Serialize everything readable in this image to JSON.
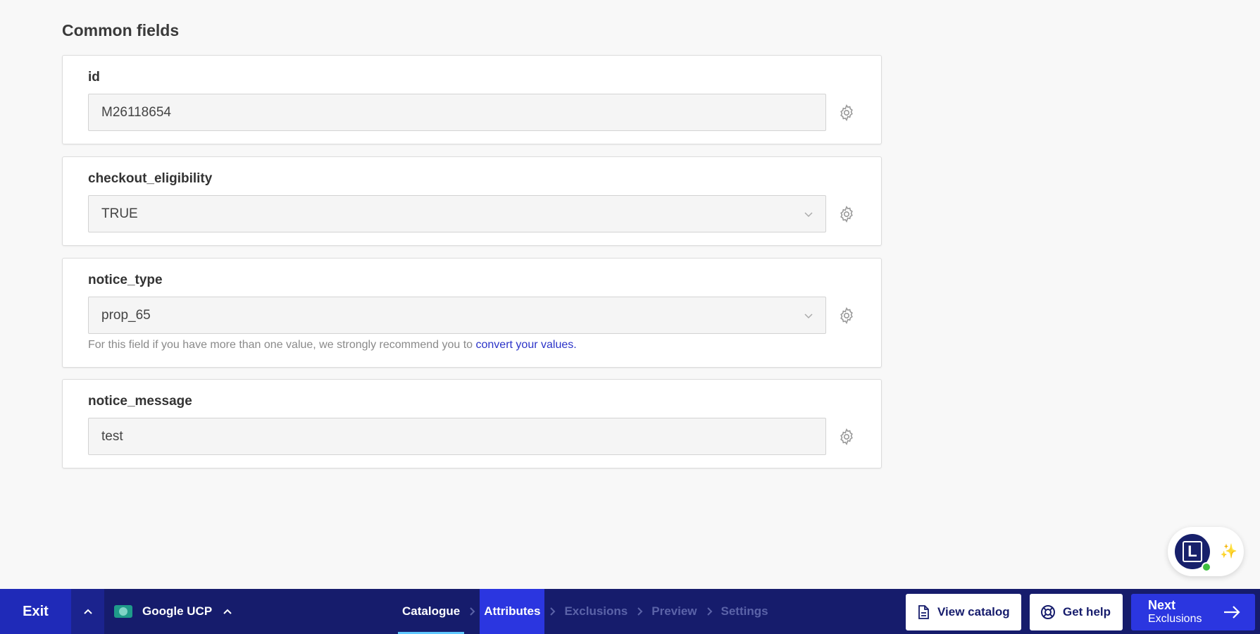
{
  "section": {
    "title": "Common fields"
  },
  "fields": [
    {
      "label": "id",
      "value": "M26118654",
      "type": "text"
    },
    {
      "label": "checkout_eligibility",
      "value": "TRUE",
      "type": "select"
    },
    {
      "label": "notice_type",
      "value": "prop_65",
      "type": "select",
      "hint": "For this field if you have more than one value, we strongly recommend you to ",
      "hint_link": "convert your values."
    },
    {
      "label": "notice_message",
      "value": "test",
      "type": "text"
    }
  ],
  "assistant": {
    "avatar_letter": "L",
    "icon": "sparkles-icon",
    "status": "online"
  },
  "bottombar": {
    "exit_label": "Exit",
    "channel_label": "Google UCP",
    "steps": [
      {
        "label": "Catalogue",
        "state": "done"
      },
      {
        "label": "Attributes",
        "state": "active"
      },
      {
        "label": "Exclusions",
        "state": "upcoming"
      },
      {
        "label": "Preview",
        "state": "upcoming"
      },
      {
        "label": "Settings",
        "state": "upcoming"
      }
    ],
    "view_catalog_label": "View catalog",
    "get_help_label": "Get help",
    "next_label": "Next",
    "next_sub_label": "Exclusions"
  },
  "colors": {
    "bar_bg": "#161c6c",
    "accent": "#2b36e0",
    "link": "#2b33c8"
  }
}
